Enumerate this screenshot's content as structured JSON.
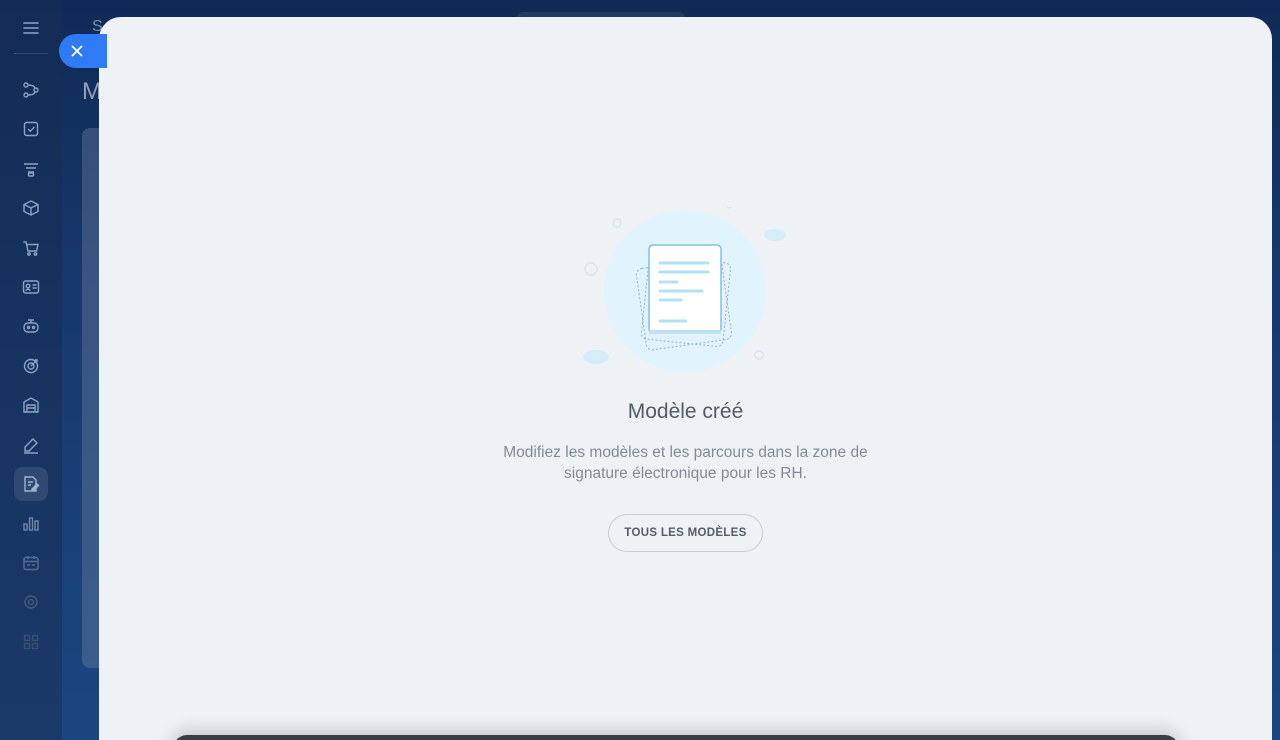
{
  "sidebar": {
    "icons": [
      {
        "name": "menu-icon"
      },
      {
        "name": "crm-icon"
      },
      {
        "name": "tasks-icon"
      },
      {
        "name": "filter-icon"
      },
      {
        "name": "box-icon"
      },
      {
        "name": "cart-icon"
      },
      {
        "name": "contact-card-icon"
      },
      {
        "name": "robot-icon"
      },
      {
        "name": "target-icon"
      },
      {
        "name": "warehouse-icon"
      },
      {
        "name": "sign-pen-icon"
      },
      {
        "name": "sign-doc-icon"
      },
      {
        "name": "analytics-icon"
      },
      {
        "name": "calendar-icon"
      },
      {
        "name": "settings-icon"
      }
    ]
  },
  "background": {
    "top_letter": "S",
    "title_letter": "M"
  },
  "modal": {
    "title": "Modèle créé",
    "description": "Modifiez les modèles et les parcours dans la zone de signature électronique pour les RH.",
    "button_label": "TOUS LES MODÈLES"
  },
  "colors": {
    "accent": "#2f7bf5",
    "modal_bg": "#eef2f5"
  }
}
